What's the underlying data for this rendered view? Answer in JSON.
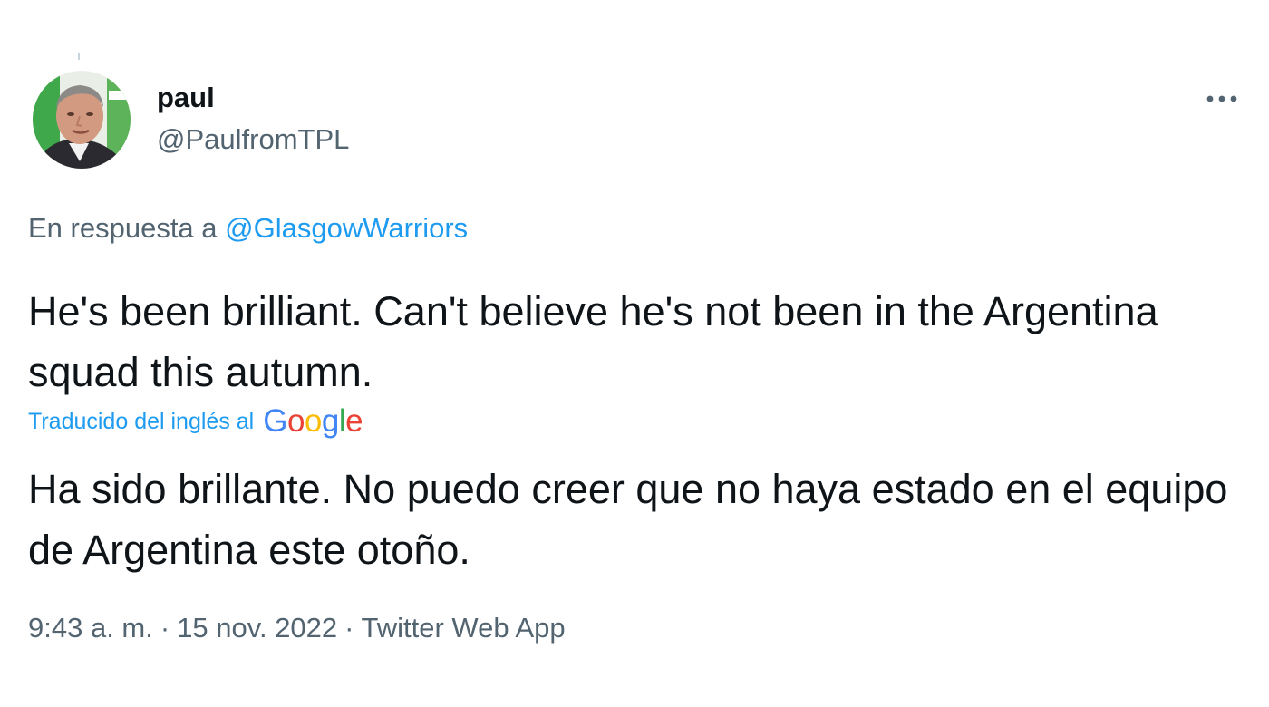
{
  "author": {
    "display_name": "paul",
    "handle": "@PaulfromTPL",
    "avatar_icon": "user-photo-avatar"
  },
  "more_icon": "more-horizontal-icon",
  "reply": {
    "prefix": "En respuesta a",
    "mention": "@GlasgowWarriors"
  },
  "tweet_text": "He's been brilliant. Can't believe he's not been in the Argentina squad this autumn.",
  "translation": {
    "label": "Traducido del inglés al",
    "provider": "Google",
    "provider_letters": [
      "G",
      "o",
      "o",
      "g",
      "l",
      "e"
    ],
    "provider_colors": [
      "#4285f4",
      "#ea4335",
      "#fbbc05",
      "#4285f4",
      "#34a853",
      "#ea4335"
    ],
    "text": "Ha sido brillante. No puedo creer que no haya estado en el equipo de Argentina este otoño."
  },
  "meta": {
    "time": "9:43 a. m.",
    "date": "15 nov. 2022",
    "source": "Twitter Web App",
    "separator": "·"
  },
  "colors": {
    "primary_text": "#0f1419",
    "secondary_text": "#536471",
    "link": "#1d9bf0"
  }
}
